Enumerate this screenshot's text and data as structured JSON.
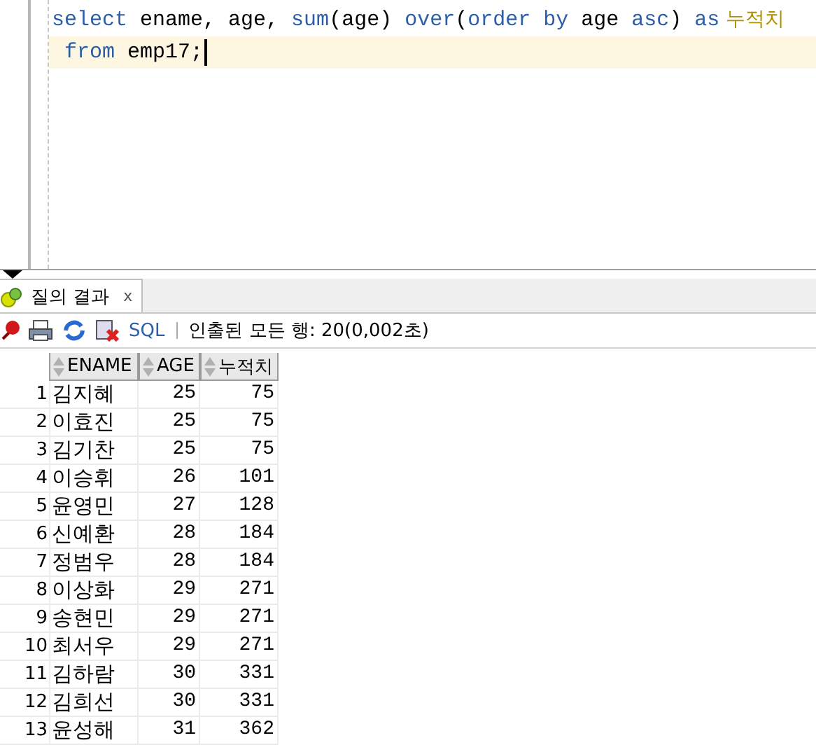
{
  "editor": {
    "lines": [
      {
        "current": false,
        "tokens": [
          {
            "kind": "keyword",
            "text": "select"
          },
          {
            "kind": "text",
            "text": " ename, age, "
          },
          {
            "kind": "keyword",
            "text": "sum"
          },
          {
            "kind": "text",
            "text": "(age) "
          },
          {
            "kind": "keyword",
            "text": "over"
          },
          {
            "kind": "text",
            "text": "("
          },
          {
            "kind": "keyword",
            "text": "order by"
          },
          {
            "kind": "text",
            "text": " age "
          },
          {
            "kind": "keyword",
            "text": "asc"
          },
          {
            "kind": "text",
            "text": ") "
          },
          {
            "kind": "keyword",
            "text": "as"
          },
          {
            "kind": "alias",
            "text": " 누적치"
          }
        ]
      },
      {
        "current": true,
        "tokens": [
          {
            "kind": "keyword",
            "text": " from"
          },
          {
            "kind": "text",
            "text": " emp17;"
          }
        ]
      }
    ]
  },
  "tabs": [
    {
      "label": "질의 결과",
      "close": "x",
      "selected": true
    }
  ],
  "toolbar": {
    "sql_link": "SQL",
    "status": "인출된 모든 행: 20(0,002초)"
  },
  "table": {
    "columns": [
      "ENAME",
      "AGE",
      "누적치"
    ],
    "rows": [
      {
        "no": "1",
        "cells": [
          "김지혜",
          "25",
          "75"
        ]
      },
      {
        "no": "2",
        "cells": [
          "이효진",
          "25",
          "75"
        ]
      },
      {
        "no": "3",
        "cells": [
          "김기찬",
          "25",
          "75"
        ]
      },
      {
        "no": "4",
        "cells": [
          "이승휘",
          "26",
          "101"
        ]
      },
      {
        "no": "5",
        "cells": [
          "윤영민",
          "27",
          "128"
        ]
      },
      {
        "no": "6",
        "cells": [
          "신예환",
          "28",
          "184"
        ]
      },
      {
        "no": "7",
        "cells": [
          "정범우",
          "28",
          "184"
        ]
      },
      {
        "no": "8",
        "cells": [
          "이상화",
          "29",
          "271"
        ]
      },
      {
        "no": "9",
        "cells": [
          "송현민",
          "29",
          "271"
        ]
      },
      {
        "no": "10",
        "cells": [
          "최서우",
          "29",
          "271"
        ]
      },
      {
        "no": "11",
        "cells": [
          "김하람",
          "30",
          "331"
        ]
      },
      {
        "no": "12",
        "cells": [
          "김희선",
          "30",
          "331"
        ]
      },
      {
        "no": "13",
        "cells": [
          "윤성해",
          "31",
          "362"
        ]
      }
    ]
  }
}
